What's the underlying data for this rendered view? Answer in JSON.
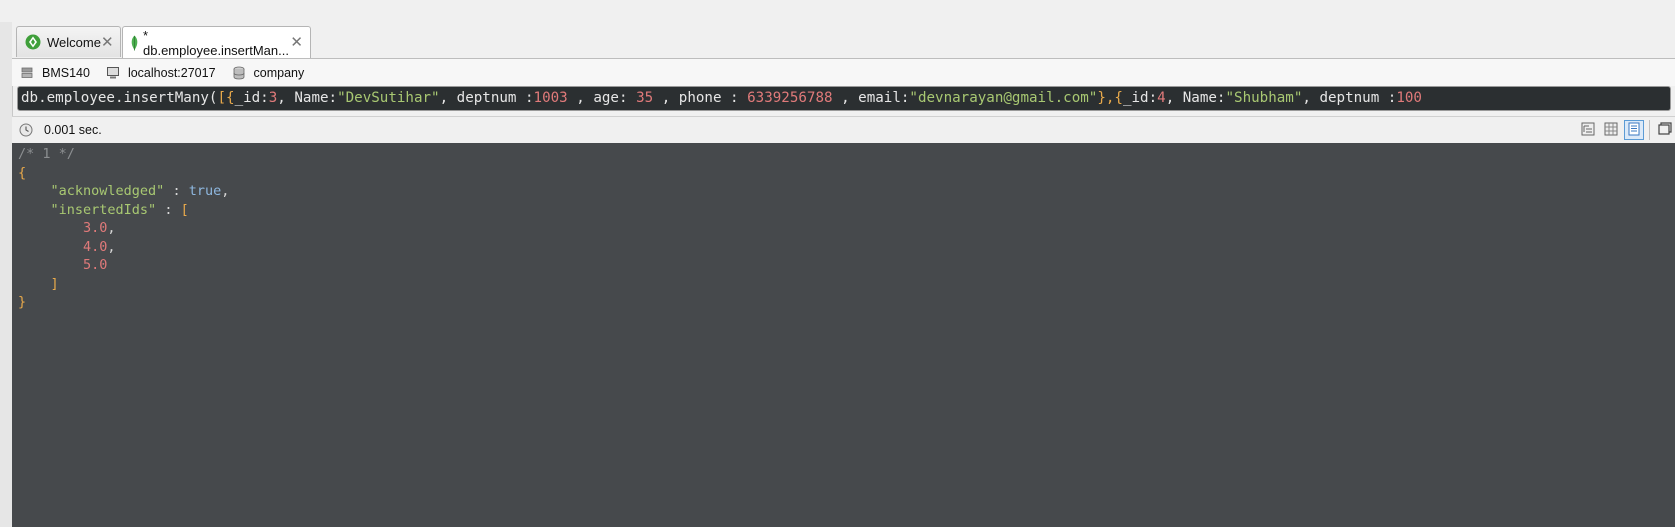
{
  "tabs": [
    {
      "label": "Welcome",
      "active": false
    },
    {
      "label": "* db.employee.insertMan...",
      "active": true
    }
  ],
  "connection": {
    "server": "BMS140",
    "host": "localhost:27017",
    "database": "company"
  },
  "query": {
    "segments": [
      {
        "t": "db.employee.insertMany(",
        "c": "plain"
      },
      {
        "t": "[{",
        "c": "orange"
      },
      {
        "t": "_id:",
        "c": "plain"
      },
      {
        "t": "3",
        "c": "num"
      },
      {
        "t": ", Name:",
        "c": "plain"
      },
      {
        "t": "\"DevSutihar\"",
        "c": "str"
      },
      {
        "t": ", deptnum :",
        "c": "plain"
      },
      {
        "t": "1003",
        "c": "num"
      },
      {
        "t": " , age: ",
        "c": "plain"
      },
      {
        "t": "35",
        "c": "num"
      },
      {
        "t": " , phone : ",
        "c": "plain"
      },
      {
        "t": "6339256788",
        "c": "num"
      },
      {
        "t": " , email:",
        "c": "plain"
      },
      {
        "t": "\"devnarayan@gmail.com\"",
        "c": "str"
      },
      {
        "t": "},{",
        "c": "orange"
      },
      {
        "t": "_id:",
        "c": "plain"
      },
      {
        "t": "4",
        "c": "num"
      },
      {
        "t": ", Name:",
        "c": "plain"
      },
      {
        "t": "\"Shubham\"",
        "c": "str"
      },
      {
        "t": ", deptnum :",
        "c": "plain"
      },
      {
        "t": "100",
        "c": "num"
      }
    ]
  },
  "status": {
    "time": "0.001 sec."
  },
  "result": {
    "comment": "/* 1 */",
    "open_brace": "{",
    "key_acknowledged": "\"acknowledged\"",
    "colon": " : ",
    "value_acknowledged": "true",
    "key_insertedIds": "\"insertedIds\"",
    "open_bracket": "[",
    "ids": [
      "3.0",
      "4.0",
      "5.0"
    ],
    "close_bracket": "]",
    "close_brace": "}"
  },
  "colors": {
    "editor_bg": "#46494c",
    "query_bg": "#2b2f31",
    "string": "#a8c872",
    "number": "#e07a7a",
    "brace": "#e8a94b",
    "accent": "#5b9bd5"
  },
  "icons": [
    "robo3t-leaf-icon",
    "mongodb-leaf-icon",
    "close-icon",
    "server-icon",
    "computer-icon",
    "database-icon",
    "clock-icon",
    "tree-view-icon",
    "table-view-icon",
    "text-view-icon",
    "maximize-icon"
  ]
}
